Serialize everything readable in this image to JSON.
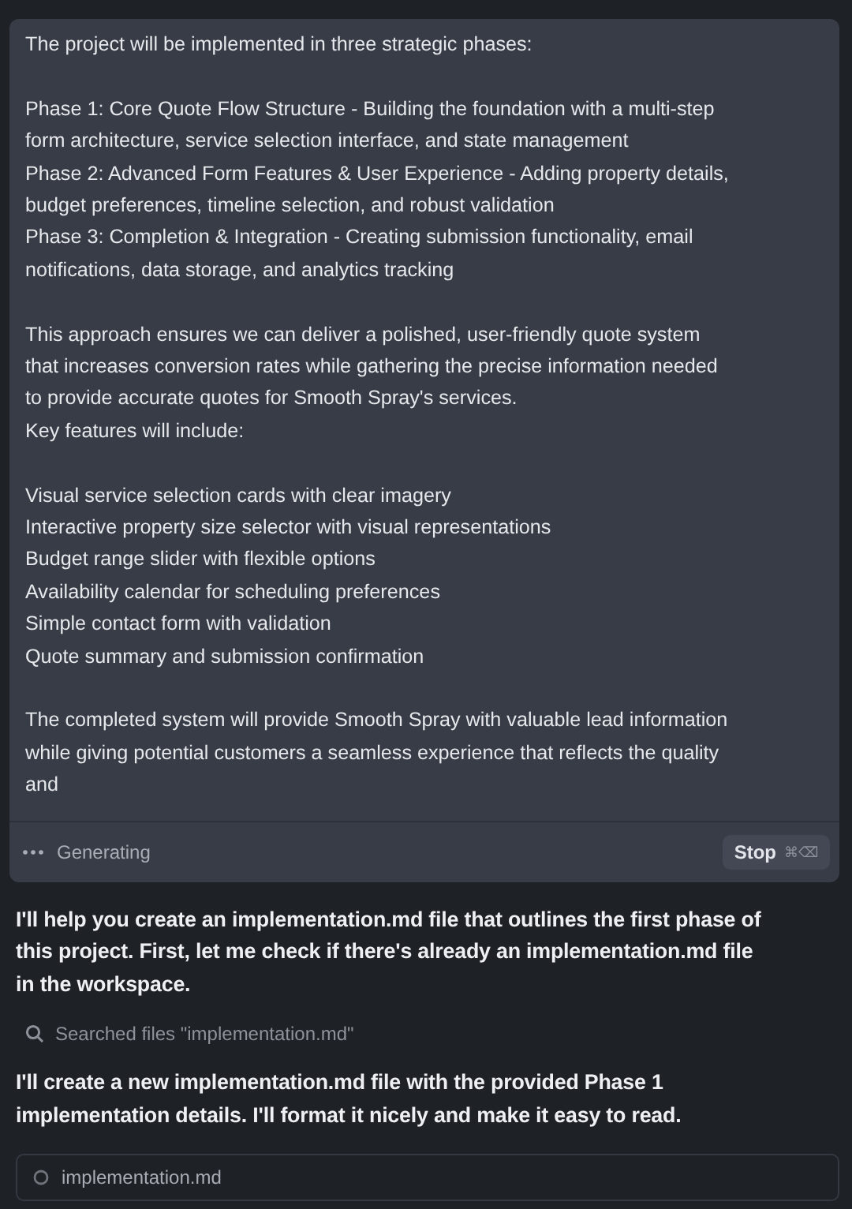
{
  "response_panel": {
    "paragraphs": [
      {
        "lines": [
          "The project will be implemented in three strategic phases:"
        ]
      },
      {
        "lines": [
          "Phase 1: Core Quote Flow Structure - Building the foundation with a multi-step",
          "form architecture, service selection interface, and state management",
          "Phase 2: Advanced Form Features & User Experience - Adding property details,",
          "budget preferences, timeline selection, and robust validation",
          "Phase 3: Completion & Integration - Creating submission functionality, email",
          "notifications, data storage, and analytics tracking"
        ]
      },
      {
        "lines": [
          "This approach ensures we can deliver a polished, user-friendly quote system",
          "that increases conversion rates while gathering the precise information needed",
          "to provide accurate quotes for Smooth Spray's services.",
          "Key features will include:"
        ]
      },
      {
        "lines": [
          "Visual service selection cards with clear imagery",
          "Interactive property size selector with visual representations",
          "Budget range slider with flexible options",
          "Availability calendar for scheduling preferences",
          "Simple contact form with validation",
          "Quote summary and submission confirmation"
        ]
      },
      {
        "lines": [
          "The completed system will provide Smooth Spray with valuable lead information",
          "while giving potential customers a seamless experience that reflects the quality",
          "and"
        ]
      }
    ],
    "status": "Generating",
    "stop_button": {
      "label": "Stop",
      "shortcut": "⌘⌫"
    }
  },
  "messages": [
    {
      "kind": "text",
      "lines": [
        "I'll help you create an implementation.md file that outlines the first phase of",
        "this project. First, let me check if there's already an implementation.md file",
        "in the workspace."
      ]
    },
    {
      "kind": "tool",
      "text": "Searched files \"implementation.md\""
    },
    {
      "kind": "text",
      "lines": [
        "I'll create a new implementation.md file with the provided Phase 1",
        "implementation details. I'll format it nicely and make it easy to read."
      ]
    },
    {
      "kind": "file",
      "text": "implementation.md"
    }
  ]
}
